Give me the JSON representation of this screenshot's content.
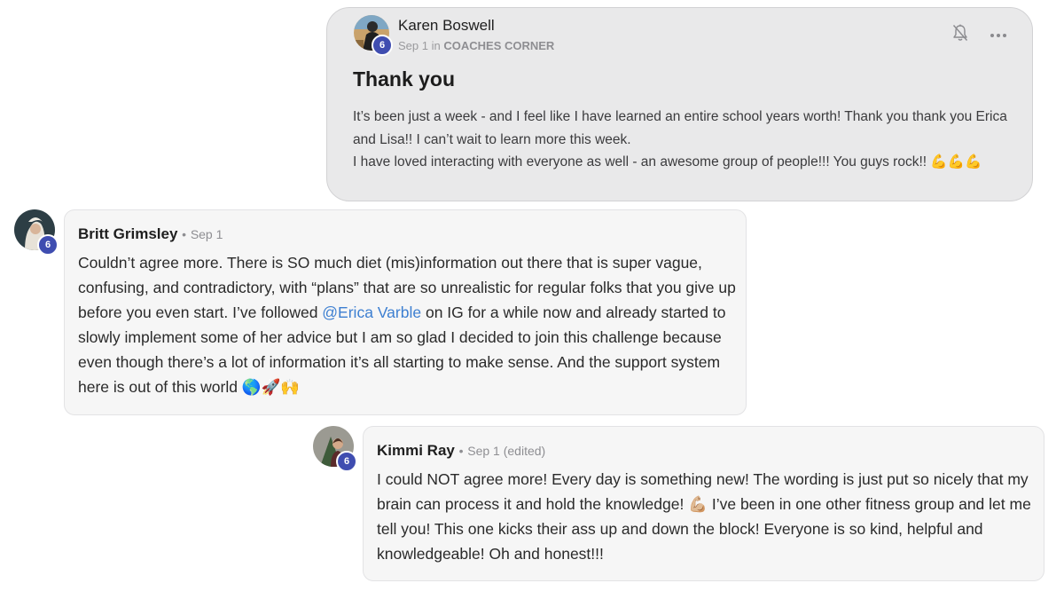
{
  "post": {
    "author": "Karen Boswell",
    "date": "Sep 1",
    "in_word": "in",
    "category": "COACHES CORNER",
    "level": "6",
    "title": "Thank you",
    "body_line1": "It’s been just a week - and I feel like I have learned an entire school years worth! Thank you thank you Erica and Lisa!! I can’t wait to learn more this week.",
    "body_line2": "I have loved interacting with everyone as well - an awesome group of people!!! You guys rock!! 💪💪💪",
    "icons": {
      "bell": "bell-icon",
      "more": "more-dots-icon"
    }
  },
  "comments": [
    {
      "author": "Britt Grimsley",
      "separator": "•",
      "time": "Sep 1",
      "level": "6",
      "text_before": "Couldn’t agree more. There is SO much diet (mis)information out there that is super vague, confusing, and contradictory, with “plans” that are so unrealistic for regular folks that you give up before you even start. I’ve followed ",
      "mention": "@Erica Varble",
      "text_after": " on IG for a while now and already started to slowly implement some of her advice but I am so glad I decided to join this challenge because even though there’s a lot of information it’s all starting to make sense. And the support system here is out of this world 🌎🚀🙌"
    },
    {
      "author": "Kimmi Ray",
      "separator": "•",
      "time": "Sep 1 (edited)",
      "level": "6",
      "text": "I could NOT agree more! Every day is something new! The wording is just put so nicely that my brain can process it and hold the knowledge! 💪🏼 I’ve been in one other fitness group and let me tell you! This one kicks their ass up and down the block! Everyone is so kind, helpful and knowledgeable! Oh and honest!!!"
    }
  ],
  "colors": {
    "post_background": "#e9e9ea",
    "comment_background": "#f6f6f6",
    "level_badge": "#3f4db0",
    "mention_link": "#3d7fd1"
  }
}
